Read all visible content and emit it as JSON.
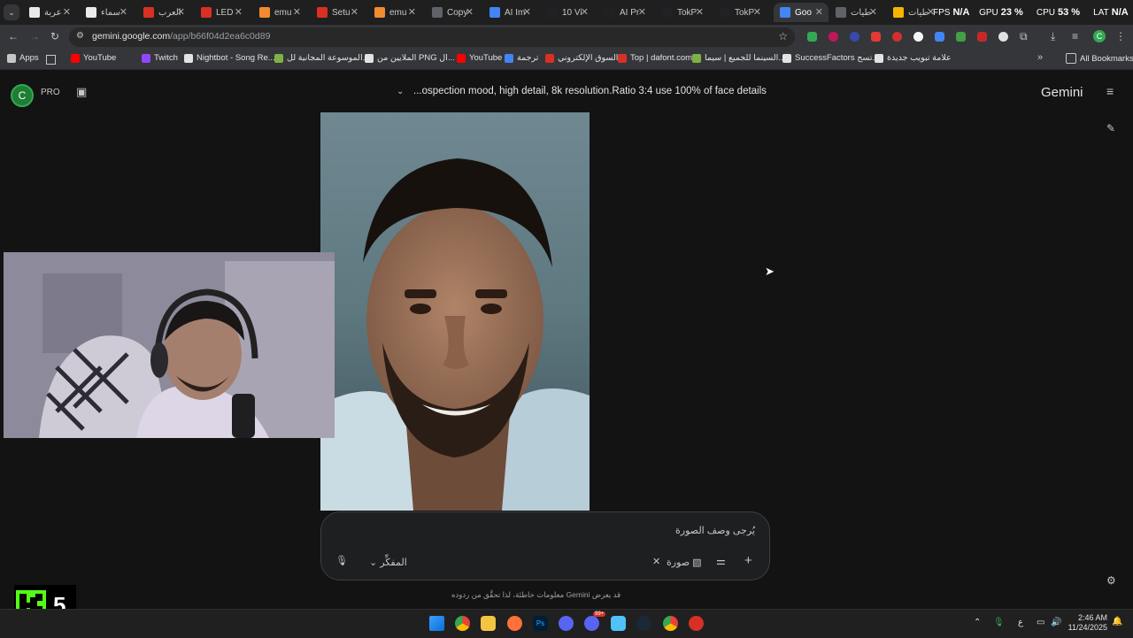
{
  "tabs": [
    {
      "label": "عربة",
      "color": "#eaeaea"
    },
    {
      "label": "سماء",
      "color": "#eaeaea"
    },
    {
      "label": "العرب",
      "color": "#d93025"
    },
    {
      "label": "LED",
      "color": "#d93025"
    },
    {
      "label": "emu",
      "color": "#f28b30"
    },
    {
      "label": "Setu",
      "color": "#d93025"
    },
    {
      "label": "emu",
      "color": "#f28b30"
    },
    {
      "label": "Copy",
      "color": "#5f6368"
    },
    {
      "label": "AI Im",
      "color": "#4285f4"
    },
    {
      "label": "10 Vi",
      "color": "#202124"
    },
    {
      "label": "AI Pr",
      "color": "#202124"
    },
    {
      "label": "TokP",
      "color": "#202124"
    },
    {
      "label": "TokP",
      "color": "#202124"
    },
    {
      "label": "Goo",
      "color": "#4285f4"
    },
    {
      "label": "طيات",
      "color": "#5f6368"
    },
    {
      "label": "طيات",
      "color": "#f4b400"
    }
  ],
  "hud": {
    "fps_label": "FPS",
    "fps_value": "N/A",
    "gpu_label": "GPU",
    "gpu_value": "23 %",
    "cpu_label": "CPU",
    "cpu_value": "53 %",
    "lat_label": "LAT",
    "lat_value": "N/A"
  },
  "address_bar": {
    "domain": "gemini.google.com",
    "path": "/app/b66f04d2ea6c0d89"
  },
  "bookmarks": [
    {
      "label": "Apps",
      "color": "#c4c7c5"
    },
    {
      "label": "YouTube",
      "color": "#ff0000"
    },
    {
      "label": "Twitch",
      "color": "#9146ff"
    },
    {
      "label": "Nightbot - Song Re...",
      "color": "#e3e3e3"
    },
    {
      "label": "الموسوعة المجانية لل...",
      "color": "#7cb342"
    },
    {
      "label": "الملايين من PNG ال...",
      "color": "#e3e3e3"
    },
    {
      "label": "YouTube",
      "color": "#ff0000"
    },
    {
      "label": "ترجمة",
      "color": "#4285f4"
    },
    {
      "label": "السوق الإلكتروني",
      "color": "#d93025"
    },
    {
      "label": "Top | dafont.com",
      "color": "#d93025"
    },
    {
      "label": "السينما للجميع | سيما...",
      "color": "#7cb342"
    },
    {
      "label": "SuccessFactors تسج...",
      "color": "#e3e3e3"
    },
    {
      "label": "علامة تبويب جديدة",
      "color": "#e3e3e3"
    }
  ],
  "all_bookmarks_label": "All Bookmarks",
  "gemini": {
    "avatar_letter": "C",
    "pro_label": "PRO",
    "conversation_title": "...ospection mood, high detail, 8k resolution.Ratio 3:4 use 100% of face details",
    "brand": "Gemini",
    "input_placeholder": "يُرجى وصف الصورة",
    "image_chip_label": "صورة",
    "model_label": "المفكِّر",
    "disclaimer": "قد يعرض Gemini معلومات خاطئة، لذا تحقَّق من ردوده"
  },
  "overlay_score": "5",
  "taskbar": {
    "time": "2:46 AM",
    "date": "11/24/2025",
    "lang": "ع",
    "badge_count": "99+"
  }
}
